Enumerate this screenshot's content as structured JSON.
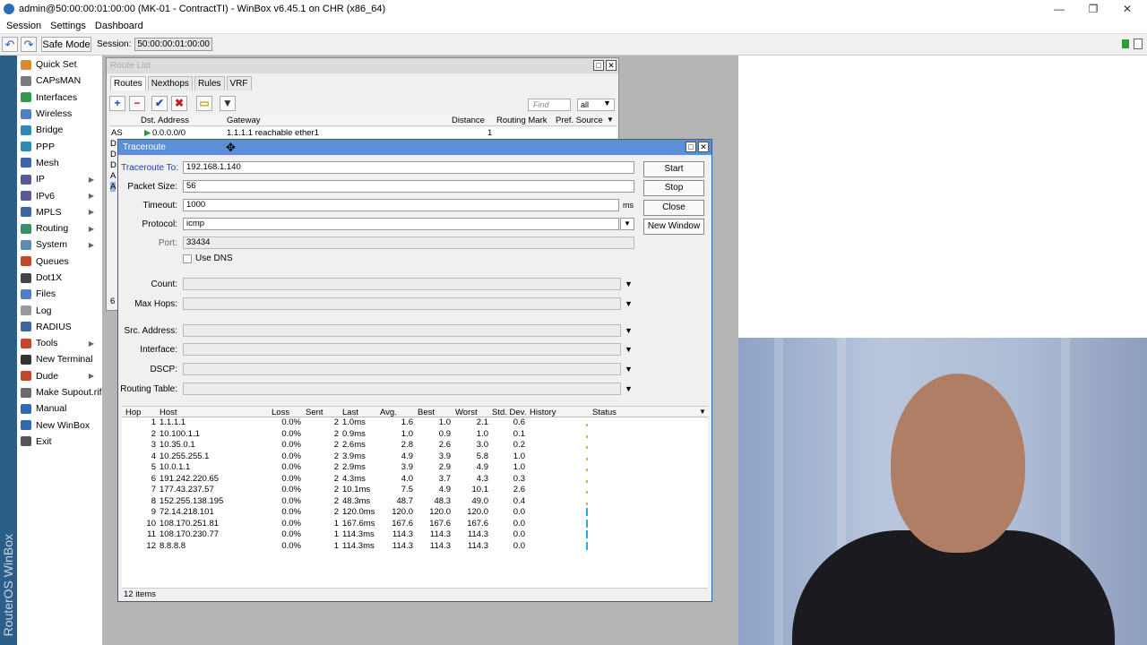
{
  "window_title": "admin@50:00:00:01:00:00 (MK-01 - ContractTI) - WinBox v6.45.1 on CHR (x86_64)",
  "menu": [
    "Session",
    "Settings",
    "Dashboard"
  ],
  "toolbar": {
    "undo": "↶",
    "redo": "↷",
    "safe_mode": "Safe Mode",
    "session_label": "Session:",
    "session_value": "50:00:00:01:00:00"
  },
  "branding": "RouterOS WinBox",
  "sidebar": [
    {
      "label": "Quick Set",
      "color": "#d98a2b",
      "sub": false
    },
    {
      "label": "CAPsMAN",
      "color": "#7a7a7a",
      "sub": false
    },
    {
      "label": "Interfaces",
      "color": "#2e9a4a",
      "sub": false
    },
    {
      "label": "Wireless",
      "color": "#4c7fc7",
      "sub": false
    },
    {
      "label": "Bridge",
      "color": "#2e8ab5",
      "sub": false
    },
    {
      "label": "PPP",
      "color": "#2e8ab5",
      "sub": false
    },
    {
      "label": "Mesh",
      "color": "#3a66a8",
      "sub": false
    },
    {
      "label": "IP",
      "color": "#5a5a9a",
      "sub": true
    },
    {
      "label": "IPv6",
      "color": "#5a5a9a",
      "sub": true
    },
    {
      "label": "MPLS",
      "color": "#3a66a8",
      "sub": true
    },
    {
      "label": "Routing",
      "color": "#3a8f6a",
      "sub": true
    },
    {
      "label": "System",
      "color": "#5a8ab5",
      "sub": true
    },
    {
      "label": "Queues",
      "color": "#c2472b",
      "sub": false
    },
    {
      "label": "Dot1X",
      "color": "#444444",
      "sub": false
    },
    {
      "label": "Files",
      "color": "#4c7fc7",
      "sub": false
    },
    {
      "label": "Log",
      "color": "#9a9a9a",
      "sub": false
    },
    {
      "label": "RADIUS",
      "color": "#3a66a8",
      "sub": false
    },
    {
      "label": "Tools",
      "color": "#c2472b",
      "sub": true
    },
    {
      "label": "New Terminal",
      "color": "#333333",
      "sub": false
    },
    {
      "label": "Dude",
      "color": "#c2472b",
      "sub": true
    },
    {
      "label": "Make Supout.rif",
      "color": "#6a6a6a",
      "sub": false
    },
    {
      "label": "Manual",
      "color": "#2e6ab5",
      "sub": false
    },
    {
      "label": "New WinBox",
      "color": "#2e6ab5",
      "sub": false
    },
    {
      "label": "Exit",
      "color": "#555555",
      "sub": false
    }
  ],
  "route_list": {
    "title": "Route List",
    "tabs": [
      "Routes",
      "Nexthops",
      "Rules",
      "VRF"
    ],
    "find_placeholder": "Find",
    "filter_value": "all",
    "columns": [
      "Dst. Address",
      "Gateway",
      "Distance",
      "Routing Mark",
      "Pref. Source"
    ],
    "row": {
      "flag": "AS",
      "dst": "0.0.0.0/0",
      "gateway": "1.1.1.1 reachable ether1",
      "distance": "1"
    },
    "left_flags": [
      "D",
      "D",
      "D",
      "A",
      "A"
    ],
    "count_fragment": "6"
  },
  "traceroute": {
    "title": "Traceroute",
    "fields": {
      "traceroute_to": {
        "label": "Traceroute To:",
        "value": "192.168.1.140"
      },
      "packet_size": {
        "label": "Packet Size:",
        "value": "56"
      },
      "timeout": {
        "label": "Timeout:",
        "value": "1000",
        "unit": "ms"
      },
      "protocol": {
        "label": "Protocol:",
        "value": "icmp"
      },
      "port": {
        "label": "Port:",
        "value": "33434"
      },
      "use_dns": {
        "label": "Use DNS"
      },
      "count": {
        "label": "Count:",
        "value": ""
      },
      "max_hops": {
        "label": "Max Hops:",
        "value": ""
      },
      "src_address": {
        "label": "Src. Address:",
        "value": ""
      },
      "interface": {
        "label": "Interface:",
        "value": ""
      },
      "dscp": {
        "label": "DSCP:",
        "value": ""
      },
      "routing_table": {
        "label": "Routing Table:",
        "value": ""
      }
    },
    "buttons": {
      "start": "Start",
      "stop": "Stop",
      "close": "Close",
      "new_window": "New Window"
    },
    "columns": [
      "Hop",
      "Host",
      "Loss",
      "Sent",
      "Last",
      "Avg.",
      "Best",
      "Worst",
      "Std. Dev.",
      "History",
      "Status"
    ],
    "hops": [
      {
        "hop": "1",
        "host": "1.1.1.1",
        "loss": "0.0%",
        "sent": "2",
        "last": "1.0ms",
        "avg": "1.6",
        "best": "1.0",
        "worst": "2.1",
        "std": "0.6"
      },
      {
        "hop": "2",
        "host": "10.100.1.1",
        "loss": "0.0%",
        "sent": "2",
        "last": "0.9ms",
        "avg": "1.0",
        "best": "0.9",
        "worst": "1.0",
        "std": "0.1"
      },
      {
        "hop": "3",
        "host": "10.35.0.1",
        "loss": "0.0%",
        "sent": "2",
        "last": "2.6ms",
        "avg": "2.8",
        "best": "2.6",
        "worst": "3.0",
        "std": "0.2"
      },
      {
        "hop": "4",
        "host": "10.255.255.1",
        "loss": "0.0%",
        "sent": "2",
        "last": "3.9ms",
        "avg": "4.9",
        "best": "3.9",
        "worst": "5.8",
        "std": "1.0"
      },
      {
        "hop": "5",
        "host": "10.0.1.1",
        "loss": "0.0%",
        "sent": "2",
        "last": "2.9ms",
        "avg": "3.9",
        "best": "2.9",
        "worst": "4.9",
        "std": "1.0"
      },
      {
        "hop": "6",
        "host": "191.242.220.65",
        "loss": "0.0%",
        "sent": "2",
        "last": "4.3ms",
        "avg": "4.0",
        "best": "3.7",
        "worst": "4.3",
        "std": "0.3"
      },
      {
        "hop": "7",
        "host": "177.43.237.57",
        "loss": "0.0%",
        "sent": "2",
        "last": "10.1ms",
        "avg": "7.5",
        "best": "4.9",
        "worst": "10.1",
        "std": "2.6"
      },
      {
        "hop": "8",
        "host": "152.255.138.195",
        "loss": "0.0%",
        "sent": "2",
        "last": "48.3ms",
        "avg": "48.7",
        "best": "48.3",
        "worst": "49.0",
        "std": "0.4"
      },
      {
        "hop": "9",
        "host": "72.14.218.101",
        "loss": "0.0%",
        "sent": "2",
        "last": "120.0ms",
        "avg": "120.0",
        "best": "120.0",
        "worst": "120.0",
        "std": "0.0"
      },
      {
        "hop": "10",
        "host": "108.170.251.81",
        "loss": "0.0%",
        "sent": "1",
        "last": "167.6ms",
        "avg": "167.6",
        "best": "167.6",
        "worst": "167.6",
        "std": "0.0"
      },
      {
        "hop": "11",
        "host": "108.170.230.77",
        "loss": "0.0%",
        "sent": "1",
        "last": "114.3ms",
        "avg": "114.3",
        "best": "114.3",
        "worst": "114.3",
        "std": "0.0"
      },
      {
        "hop": "12",
        "host": "8.8.8.8",
        "loss": "0.0%",
        "sent": "1",
        "last": "114.3ms",
        "avg": "114.3",
        "best": "114.3",
        "worst": "114.3",
        "std": "0.0"
      }
    ],
    "footer": "12 items"
  },
  "colors": {
    "accent": "#5c8fd6",
    "label_blue": "#1a3fb0",
    "history_tall": "#33aadd",
    "history_short": "#e0b040"
  }
}
